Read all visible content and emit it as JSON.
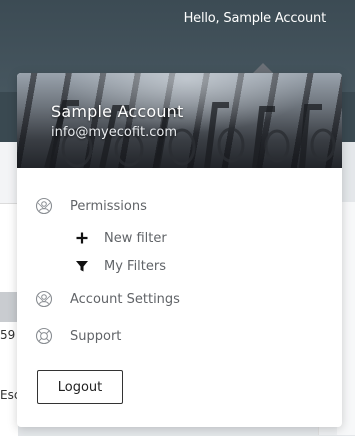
{
  "header": {
    "greeting": "Hello, Sample Account"
  },
  "background": {
    "fragment_a": "59",
    "fragment_b": "Esc"
  },
  "account_menu": {
    "name": "Sample Account",
    "email": "info@myecofit.com",
    "items": [
      {
        "label": "Permissions",
        "icon": "shield-user-icon"
      },
      {
        "label": "New filter",
        "icon": "plus-icon"
      },
      {
        "label": "My Filters",
        "icon": "filter-icon"
      },
      {
        "label": "Account Settings",
        "icon": "settings-user-icon"
      },
      {
        "label": "Support",
        "icon": "lifebuoy-icon"
      }
    ],
    "logout_label": "Logout"
  },
  "colors": {
    "header_bg": "#3c4b54",
    "menu_text": "#616468",
    "icon_gray": "#8a8e93"
  }
}
